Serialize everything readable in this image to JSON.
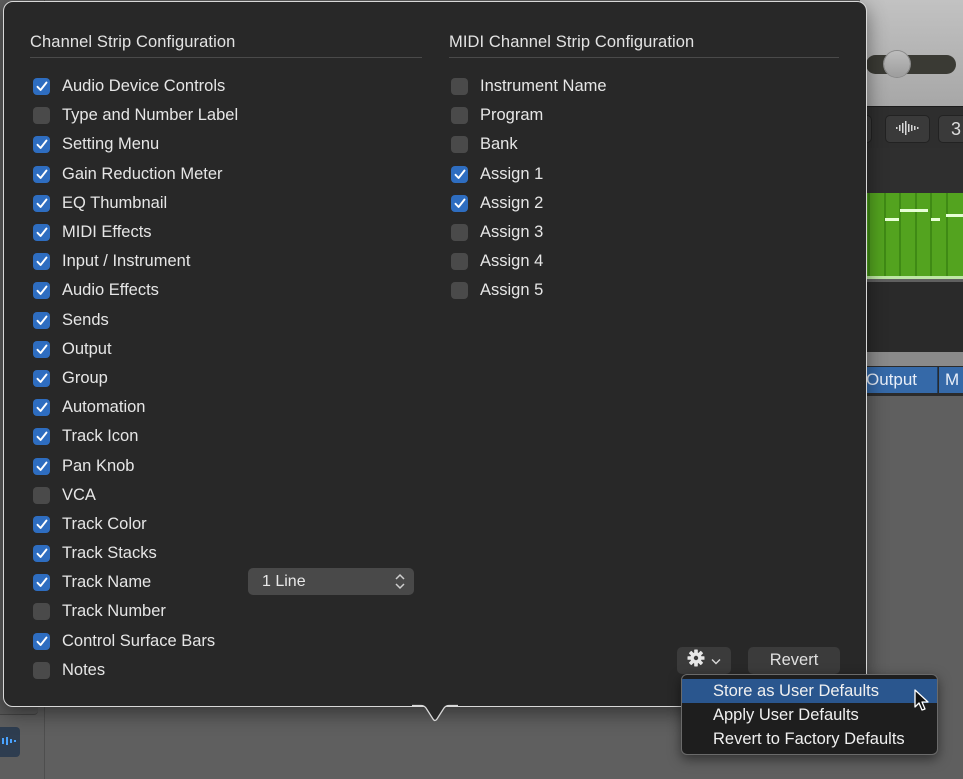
{
  "background_app": {
    "output_button_label": "Output",
    "next_button_label_partial": "M",
    "toolbar_partial_label": "3",
    "colors": {
      "region_green": "#53a31f",
      "output_blue": "#3569a8",
      "accent_waveform_blue": "#4aa3ff"
    }
  },
  "channel_strip": {
    "title": "Channel Strip Configuration",
    "items": [
      {
        "label": "Audio Device Controls",
        "checked": true
      },
      {
        "label": "Type and Number Label",
        "checked": false
      },
      {
        "label": "Setting Menu",
        "checked": true
      },
      {
        "label": "Gain Reduction Meter",
        "checked": true
      },
      {
        "label": "EQ Thumbnail",
        "checked": true
      },
      {
        "label": "MIDI Effects",
        "checked": true
      },
      {
        "label": "Input / Instrument",
        "checked": true
      },
      {
        "label": "Audio Effects",
        "checked": true
      },
      {
        "label": "Sends",
        "checked": true
      },
      {
        "label": "Output",
        "checked": true
      },
      {
        "label": "Group",
        "checked": true
      },
      {
        "label": "Automation",
        "checked": true
      },
      {
        "label": "Track Icon",
        "checked": true
      },
      {
        "label": "Pan Knob",
        "checked": true
      },
      {
        "label": "VCA",
        "checked": false
      },
      {
        "label": "Track Color",
        "checked": true
      },
      {
        "label": "Track Stacks",
        "checked": true
      },
      {
        "label": "Track Name",
        "checked": true
      },
      {
        "label": "Track Number",
        "checked": false
      },
      {
        "label": "Control Surface Bars",
        "checked": true
      },
      {
        "label": "Notes",
        "checked": false
      }
    ],
    "track_name_lines": {
      "selected": "1 Line"
    }
  },
  "midi_channel_strip": {
    "title": "MIDI Channel Strip Configuration",
    "items": [
      {
        "label": "Instrument Name",
        "checked": false
      },
      {
        "label": "Program",
        "checked": false
      },
      {
        "label": "Bank",
        "checked": false
      },
      {
        "label": "Assign 1",
        "checked": true
      },
      {
        "label": "Assign 2",
        "checked": true
      },
      {
        "label": "Assign 3",
        "checked": false
      },
      {
        "label": "Assign 4",
        "checked": false
      },
      {
        "label": "Assign 5",
        "checked": false
      }
    ]
  },
  "footer": {
    "gear_menu_icon": "gear-icon",
    "revert_label": "Revert"
  },
  "gear_menu": {
    "items": [
      {
        "label": "Store as User Defaults",
        "highlighted": true
      },
      {
        "label": "Apply User Defaults",
        "highlighted": false
      },
      {
        "label": "Revert to Factory Defaults",
        "highlighted": false
      }
    ]
  },
  "colors": {
    "checkbox_checked": "#2e6dc0",
    "checkbox_unchecked": "#4a4a4a",
    "panel_background": "#282828",
    "menu_highlight": "#2a568e"
  }
}
